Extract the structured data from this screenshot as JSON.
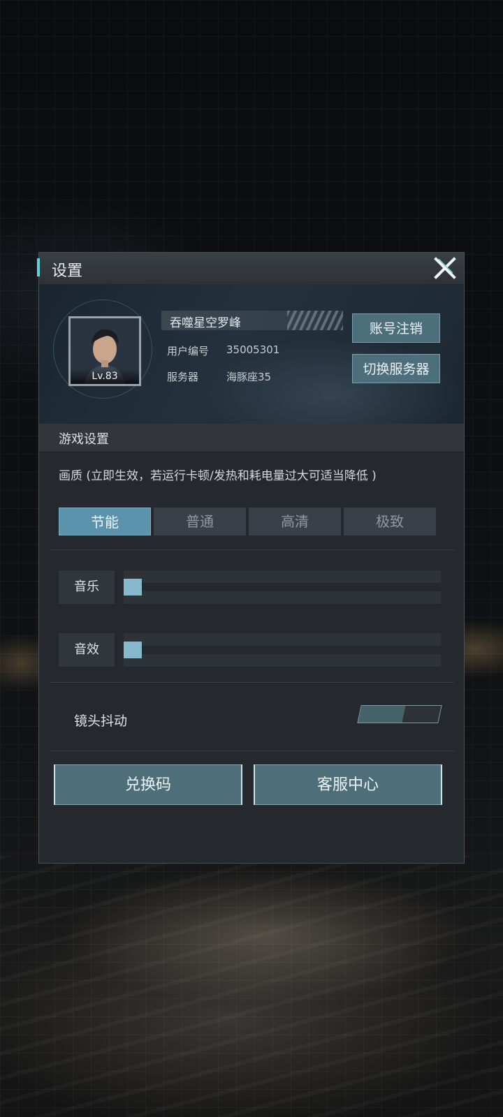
{
  "dialog": {
    "title": "设置",
    "close_icon": "close-icon"
  },
  "profile": {
    "name": "吞噬星空罗峰",
    "level": "Lv.83",
    "user_id_label": "用户编号",
    "user_id": "35005301",
    "server_label": "服务器",
    "server": "海豚座35",
    "logout_button": "账号注销",
    "switch_server_button": "切换服务器"
  },
  "game_settings": {
    "section_title": "游戏设置",
    "quality_label": "画质 (立即生效，若运行卡顿/发热和耗电量过大可适当降低 )",
    "quality_options": [
      "节能",
      "普通",
      "高清",
      "极致"
    ],
    "quality_selected": "节能",
    "music_label": "音乐",
    "music_level": 0,
    "sfx_label": "音效",
    "sfx_level": 0,
    "camera_shake_label": "镜头抖动",
    "camera_shake_on": false
  },
  "actions": {
    "redeem_code": "兑换码",
    "customer_service": "客服中心"
  },
  "colors": {
    "accent": "#5fd3dc",
    "selected": "#5b93ad",
    "button": "#4e6f7a"
  }
}
